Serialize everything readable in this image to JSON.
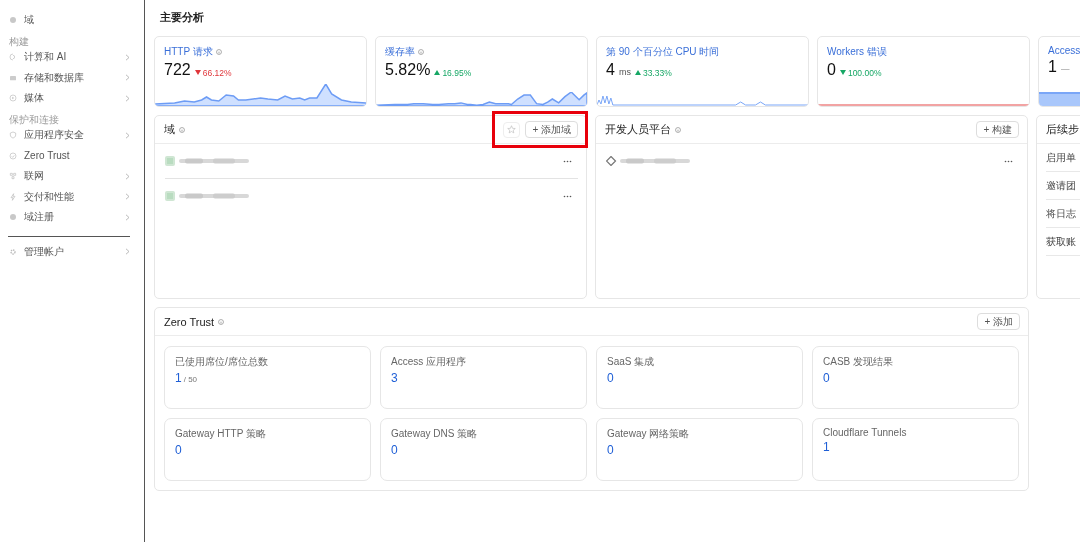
{
  "sidebar": {
    "items": [
      {
        "kind": "item",
        "label": "域",
        "has_submenu": false
      },
      {
        "kind": "header",
        "label": "构建"
      },
      {
        "kind": "item",
        "label": "计算和 AI",
        "has_submenu": true
      },
      {
        "kind": "item",
        "label": "存储和数据库",
        "has_submenu": true
      },
      {
        "kind": "item",
        "label": "媒体",
        "has_submenu": true
      },
      {
        "kind": "header",
        "label": "保护和连接"
      },
      {
        "kind": "item",
        "label": "应用程序安全",
        "has_submenu": true
      },
      {
        "kind": "item",
        "label": "Zero Trust",
        "has_submenu": false
      },
      {
        "kind": "item",
        "label": "联网",
        "has_submenu": true
      },
      {
        "kind": "item",
        "label": "交付和性能",
        "has_submenu": true
      },
      {
        "kind": "item",
        "label": "域注册",
        "has_submenu": true
      },
      {
        "kind": "divider"
      },
      {
        "kind": "item",
        "label": "管理帐户",
        "has_submenu": true
      }
    ]
  },
  "page_title": "主要分析",
  "metrics": [
    {
      "title": "HTTP 请求",
      "info": true,
      "value": "722",
      "change": "66.12%",
      "rising": false,
      "color": "#e0363b"
    },
    {
      "title": "缓存率",
      "info": true,
      "value": "5.82%",
      "change": "16.95%",
      "rising": true,
      "color": "#16a765"
    },
    {
      "title": "第 90 个百分位 CPU 时间",
      "info": false,
      "value": "4",
      "unit": "ms",
      "change": "33.33%",
      "rising": true,
      "color": "#16a765"
    },
    {
      "title": "Workers 错误",
      "info": false,
      "value": "0",
      "change": "100.00%",
      "rising": false,
      "color": "#16a765"
    },
    {
      "title": "Access",
      "info": false,
      "value": "1",
      "change": "—"
    }
  ],
  "domains_panel": {
    "title": "域",
    "add_button": "+ 添加域",
    "rows": [
      {
        "kind": "domain"
      },
      {
        "kind": "domain"
      }
    ],
    "highlighted": true
  },
  "developer_panel": {
    "title": "开发人员平台",
    "build_button": "+ 构建",
    "rows": [
      {
        "kind": "project"
      }
    ]
  },
  "next_steps": {
    "title": "后续步",
    "items": [
      "启用单",
      "邀请团",
      "将日志",
      "获取账"
    ]
  },
  "zero_trust": {
    "title": "Zero Trust",
    "add_button": "+ 添加",
    "stats": [
      {
        "label": "已使用席位/席位总数",
        "value": "1",
        "total": "/ 50"
      },
      {
        "label": "Access 应用程序",
        "value": "3"
      },
      {
        "label": "SaaS 集成",
        "value": "0"
      },
      {
        "label": "CASB 发现结果",
        "value": "0"
      },
      {
        "label": "Gateway HTTP 策略",
        "value": "0"
      },
      {
        "label": "Gateway DNS 策略",
        "value": "0"
      },
      {
        "label": "Gateway 网络策略",
        "value": "0"
      },
      {
        "label": "Cloudflare Tunnels",
        "value": "1"
      }
    ]
  }
}
